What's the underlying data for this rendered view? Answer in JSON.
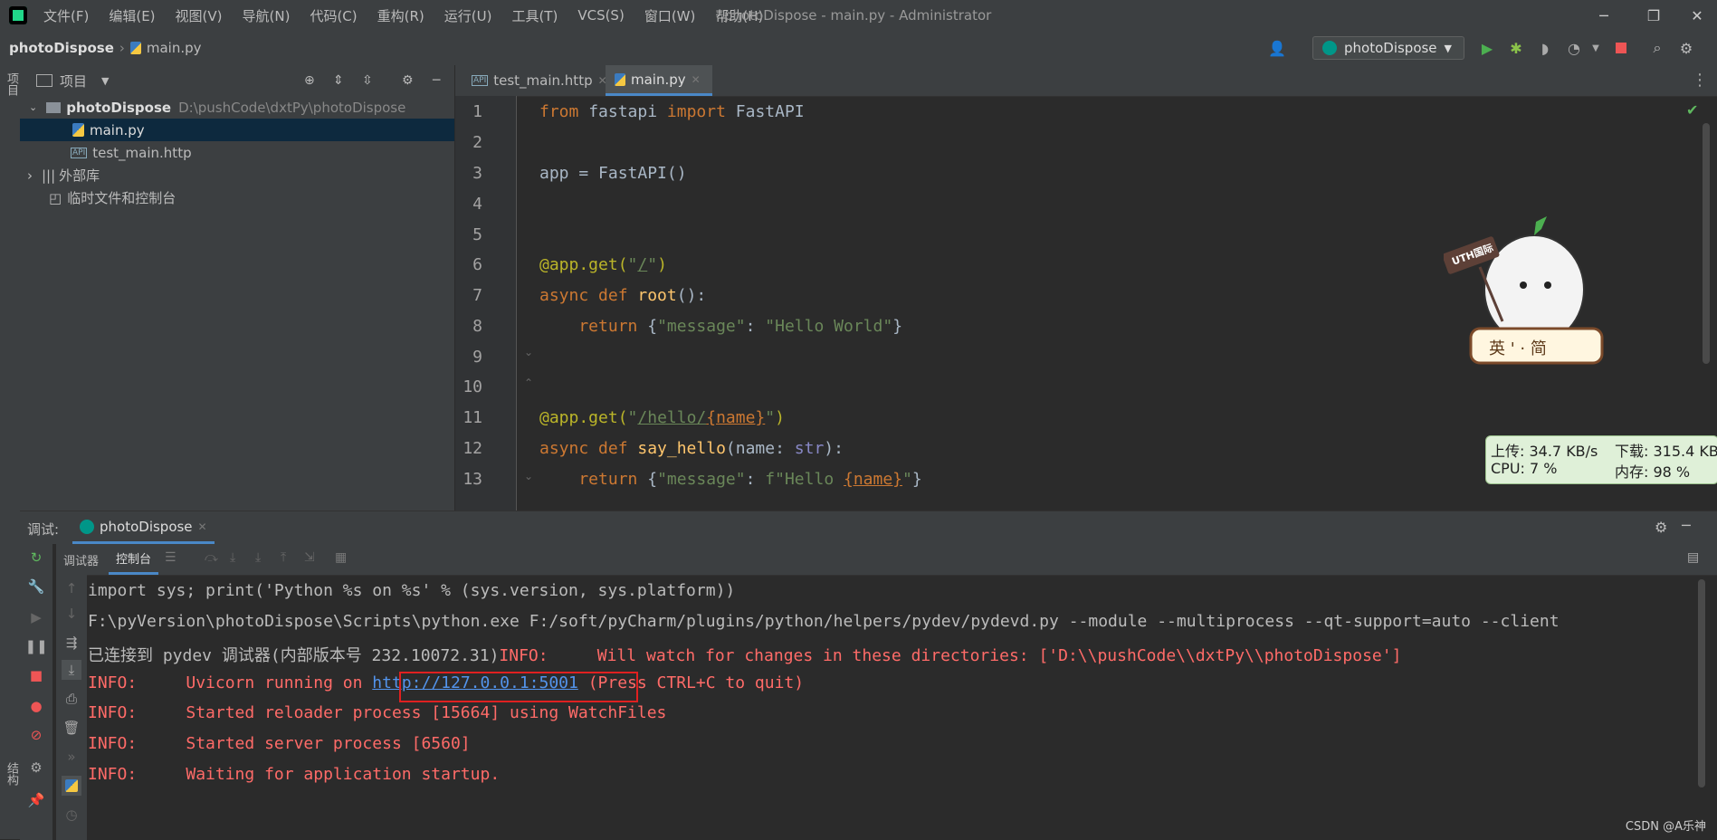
{
  "titlebar": {
    "menus": [
      "文件(F)",
      "编辑(E)",
      "视图(V)",
      "导航(N)",
      "代码(C)",
      "重构(R)",
      "运行(U)",
      "工具(T)",
      "VCS(S)",
      "窗口(W)",
      "帮助(H)"
    ],
    "title": "photoDispose - main.py - Administrator",
    "min": "─",
    "max": "❐",
    "close": "✕"
  },
  "navbar": {
    "project": "photoDispose",
    "file": "main.py",
    "run_config": "photoDispose"
  },
  "left_stripe": {
    "project_label": "项目",
    "structure_label": "结构"
  },
  "project_panel": {
    "title": "项目",
    "root_name": "photoDispose",
    "root_path": "D:\\pushCode\\dxtPy\\photoDispose",
    "files": [
      "main.py",
      "test_main.http"
    ],
    "external_libs": "外部库",
    "scratches": "临时文件和控制台"
  },
  "editor": {
    "tabs": [
      "test_main.http",
      "main.py"
    ],
    "line_numbers": [
      "1",
      "2",
      "3",
      "4",
      "5",
      "6",
      "7",
      "8",
      "9",
      "10",
      "11",
      "12",
      "13"
    ],
    "code": {
      "l1_from": "from",
      "l1_mod": " fastapi ",
      "l1_import": "import",
      "l1_name": " FastAPI",
      "l3": "app = FastAPI()",
      "l6_dec": "@app.get(",
      "l6_q1": "\"",
      "l6_path": "/",
      "l6_q2": "\"",
      "l6_close": ")",
      "l7_async": "async def ",
      "l7_fn": "root",
      "l7_rest": "():",
      "l8_ret": "    return ",
      "l8_open": "{",
      "l8_k": "\"message\"",
      "l8_colon": ": ",
      "l8_v": "\"Hello World\"",
      "l8_close": "}",
      "l11_dec": "@app.get(",
      "l11_q1": "\"",
      "l11_path": "/hello/",
      "l11_param": "{name}",
      "l11_q2": "\"",
      "l11_close": ")",
      "l12_async": "async def ",
      "l12_fn": "say_hello",
      "l12_open": "(name: ",
      "l12_type": "str",
      "l12_close": "):",
      "l13_ret": "    return ",
      "l13_open": "{",
      "l13_k": "\"message\"",
      "l13_colon": ": ",
      "l13_f": "f\"Hello ",
      "l13_param": "{name}",
      "l13_q": "\"",
      "l13_close": "}"
    }
  },
  "overlay": {
    "sign_text": "UTH国际",
    "badge_text": "英 ' · 简",
    "upload": "上传: 34.7 KB/s",
    "download": "下载: 315.4 KB",
    "cpu": "CPU: 7 %",
    "memory": "内存: 98 %"
  },
  "debug": {
    "label": "调试:",
    "session_tab": "photoDispose",
    "subtabs": [
      "调试器",
      "控制台"
    ],
    "console": {
      "line1": "import sys; print('Python %s on %s' % (sys.version, sys.platform))",
      "line2": "F:\\pyVersion\\photoDispose\\Scripts\\python.exe F:/soft/pyCharm/plugins/python/helpers/pydev/pydevd.py --module --multiprocess --qt-support=auto --client",
      "line3_prefix": "已连接到 pydev 调试器(内部版本号 232.10072.31)",
      "line3_info": "INFO:     Will watch for changes in these directories: ['D:\\\\pushCode\\\\dxtPy\\\\photoDispose']",
      "line4_info": "INFO:     Uvicorn running on ",
      "line4_link": "http://127.0.0.1:5001",
      "line4_rest": " (Press CTRL+C to quit)",
      "line5": "INFO:     Started reloader process [15664] using WatchFiles",
      "line6": "INFO:     Started server process [6560]",
      "line7": "INFO:     Waiting for application startup."
    }
  },
  "watermark": "CSDN @A乐神",
  "colors": {
    "bg": "#2b2b2b",
    "panel": "#3c3f41",
    "keyword": "#cc7832",
    "string": "#6a8759",
    "function": "#ffc66d",
    "decorator": "#bbb529",
    "error_text": "#ff6b68",
    "link": "#5394ec"
  }
}
